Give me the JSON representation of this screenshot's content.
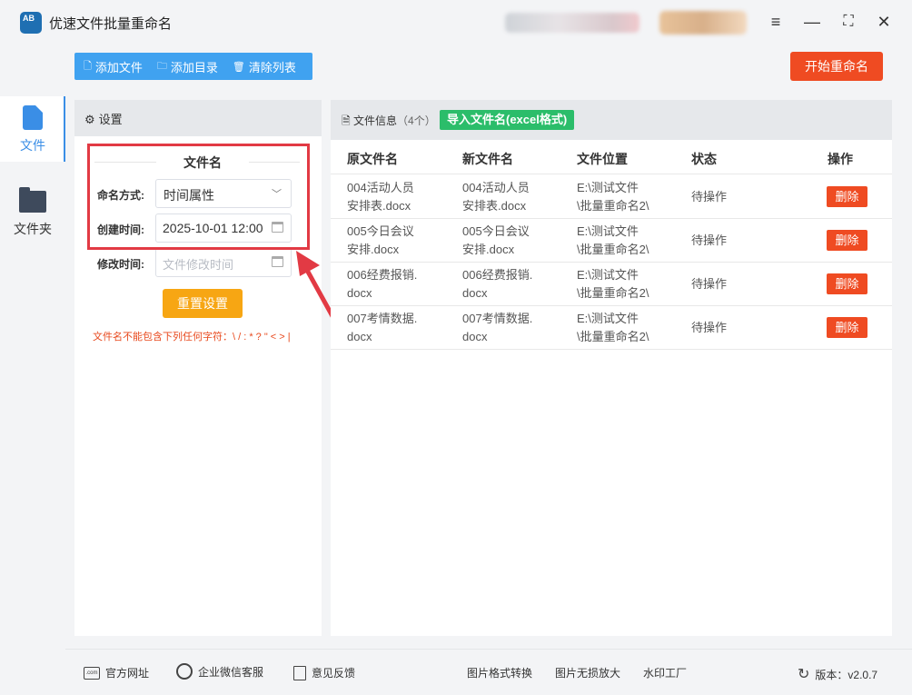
{
  "app": {
    "title": "优速文件批量重命名",
    "logo_text": "AB"
  },
  "toolbar": {
    "add_file": "添加文件",
    "add_dir": "添加目录",
    "clear_list": "清除列表",
    "start_rename": "开始重命名"
  },
  "nav": {
    "items": [
      {
        "label": "文件",
        "icon": "file-icon",
        "active": true
      },
      {
        "label": "文件夹",
        "icon": "folder-icon",
        "active": false
      }
    ]
  },
  "settings": {
    "header": "设置",
    "section_title": "文件名",
    "naming_label": "命名方式:",
    "naming_value": "时间属性",
    "created_label": "创建时间:",
    "created_value": "2025-10-01 12:00",
    "modified_label": "修改时间:",
    "modified_placeholder": "文件修改时间",
    "reset_button": "重置设置",
    "warning": "文件名不能包含下列任何字符：\\ / : * ? \" < > |"
  },
  "fileinfo": {
    "title": "文件信息",
    "count": "（4个）",
    "import_button": "导入文件名(excel格式)",
    "columns": [
      "原文件名",
      "新文件名",
      "文件位置",
      "状态",
      "操作"
    ],
    "rows": [
      {
        "orig": [
          "004活动人员",
          "安排表.docx"
        ],
        "new": [
          "004活动人员",
          "安排表.docx"
        ],
        "loc": [
          "E:\\测试文件",
          "\\批量重命名2\\"
        ],
        "status": "待操作",
        "action": "删除"
      },
      {
        "orig": [
          "005今日会议",
          "安排.docx"
        ],
        "new": [
          "005今日会议",
          "安排.docx"
        ],
        "loc": [
          "E:\\测试文件",
          "\\批量重命名2\\"
        ],
        "status": "待操作",
        "action": "删除"
      },
      {
        "orig": [
          "006经费报销.",
          "docx"
        ],
        "new": [
          "006经费报销.",
          "docx"
        ],
        "loc": [
          "E:\\测试文件",
          "\\批量重命名2\\"
        ],
        "status": "待操作",
        "action": "删除"
      },
      {
        "orig": [
          "007考情数据.",
          "docx"
        ],
        "new": [
          "007考情数据.",
          "docx"
        ],
        "loc": [
          "E:\\测试文件",
          "\\批量重命名2\\"
        ],
        "status": "待操作",
        "action": "删除"
      }
    ]
  },
  "footer": {
    "website": "官方网址",
    "wechat": "企业微信客服",
    "feedback": "意见反馈",
    "img_convert": "图片格式转换",
    "img_enlarge": "图片无损放大",
    "watermark": "水印工厂",
    "version": "版本：v2.0.7"
  },
  "colors": {
    "accent_blue": "#40a2f0",
    "start_red": "#ef4b22",
    "import_green": "#2bbd6a",
    "reset_orange": "#f7a613",
    "highlight_red": "#e23a44"
  }
}
